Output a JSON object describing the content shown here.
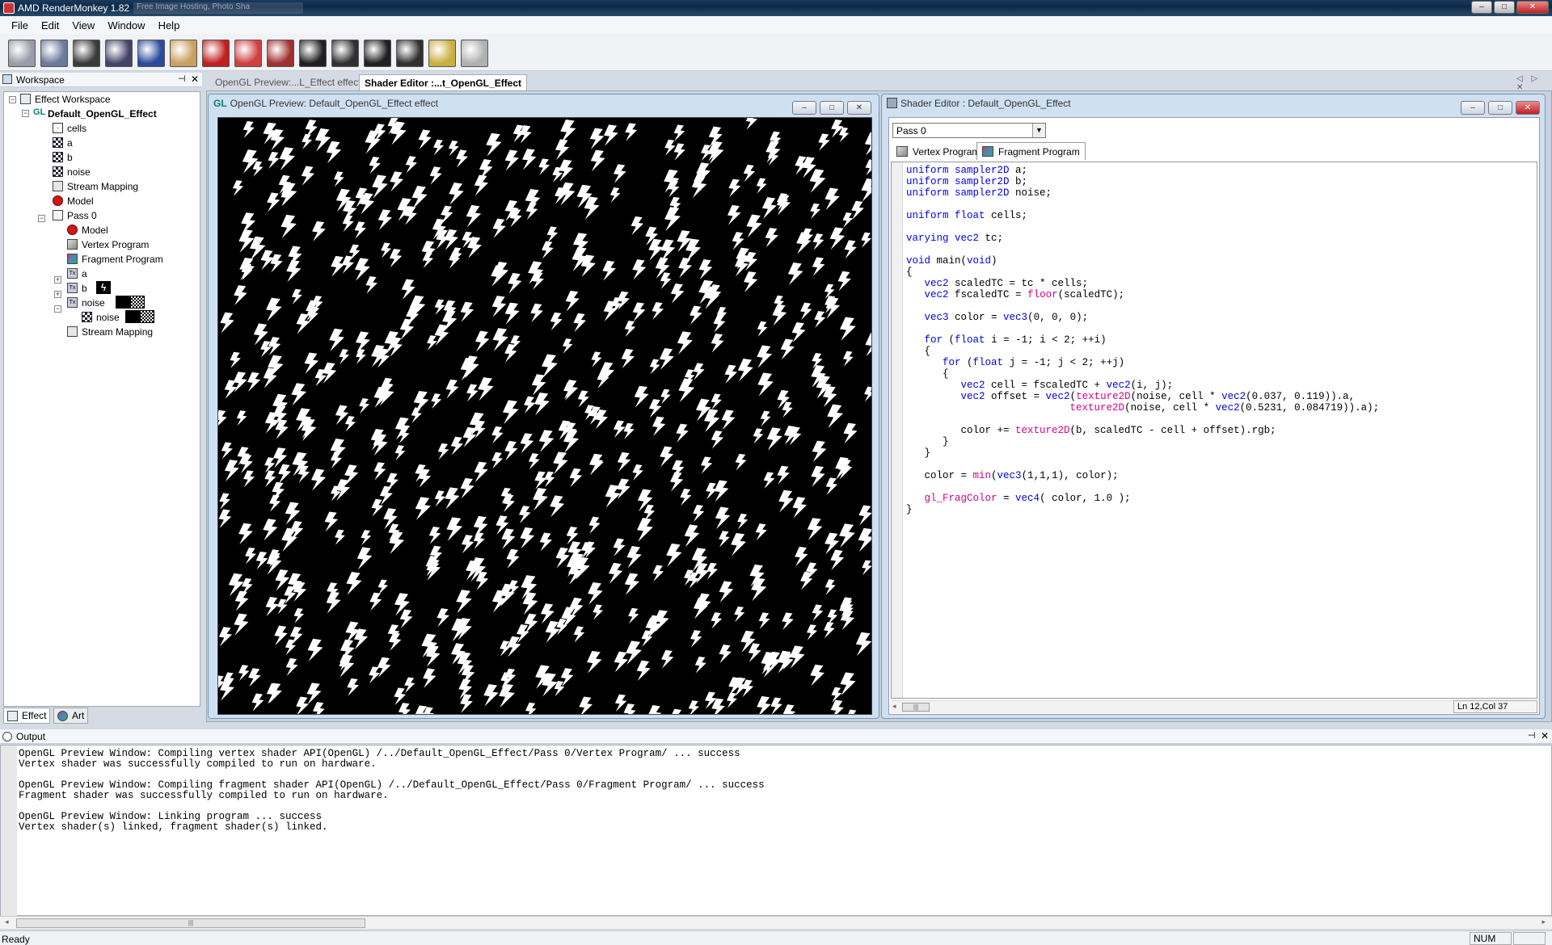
{
  "app": {
    "title": "AMD RenderMonkey 1.82",
    "ghost_tab": "Free Image Hosting, Photo Sha",
    "window_buttons": {
      "minimize": "–",
      "maximize": "□",
      "close": "✕"
    }
  },
  "menu": {
    "items": [
      "File",
      "Edit",
      "View",
      "Window",
      "Help"
    ]
  },
  "toolbar": {
    "buttons": [
      {
        "name": "new-effect-button",
        "icon": "new-effect-icon",
        "color": "#9a9aa8"
      },
      {
        "name": "open-effect-button",
        "icon": "sphere-icon",
        "color": "#6a7a9a"
      },
      {
        "name": "save-effect-button",
        "icon": "save-icon",
        "color": "#3a3a3a"
      },
      {
        "name": "render-button",
        "icon": "render-icon",
        "color": "#444466"
      },
      {
        "name": "preview-button",
        "icon": "orb-icon",
        "color": "#2a4a9a"
      },
      {
        "name": "paint-button",
        "icon": "palette-icon",
        "color": "#c8a060"
      },
      {
        "name": "add-model-button",
        "icon": "model-icon",
        "color": "#c02020"
      },
      {
        "name": "add-variable-button",
        "icon": "variable-icon",
        "color": "#d04040"
      },
      {
        "name": "add-texture-button",
        "icon": "texture-icon",
        "color": "#a03030"
      },
      {
        "name": "camera-button-1",
        "icon": "camera-icon",
        "color": "#202020"
      },
      {
        "name": "camera-button-2",
        "icon": "camera-icon",
        "color": "#303030"
      },
      {
        "name": "camera-button-3",
        "icon": "camera-icon",
        "color": "#202020"
      },
      {
        "name": "camera-button-4",
        "icon": "camera-icon",
        "color": "#303030"
      },
      {
        "name": "camera-button-5",
        "icon": "camera-icon",
        "color": "#c8b040"
      },
      {
        "name": "mouse-button",
        "icon": "mouse-icon",
        "color": "#b0b0b0"
      }
    ]
  },
  "workspace": {
    "title": "Workspace",
    "pin": "⊣",
    "close": "✕",
    "tree": [
      {
        "label": "Effect Workspace",
        "icon": "workspace-icon",
        "bold": false
      },
      {
        "label": "Default_OpenGL_Effect",
        "icon": "gl-icon",
        "icon_text": "GL",
        "bold": true
      },
      {
        "label": "cells",
        "icon": "variable-icon",
        "icon_text": "·",
        "bold": false
      },
      {
        "label": "a",
        "icon": "texture-icon",
        "bold": false
      },
      {
        "label": "b",
        "icon": "texture-icon",
        "bold": false
      },
      {
        "label": "noise",
        "icon": "texture-icon",
        "bold": false
      },
      {
        "label": "Stream Mapping",
        "icon": "stream-mapping-icon",
        "bold": false
      },
      {
        "label": "Model",
        "icon": "model-icon",
        "bold": false
      },
      {
        "label": "Pass 0",
        "icon": "pass-icon",
        "bold": false
      },
      {
        "label": "Model",
        "icon": "model-icon",
        "bold": false
      },
      {
        "label": "Vertex Program",
        "icon": "vertex-program-icon",
        "bold": false
      },
      {
        "label": "Fragment Program",
        "icon": "fragment-program-icon",
        "bold": false
      },
      {
        "label": "a",
        "icon": "texture-object-icon",
        "icon_text": "Tx",
        "bold": false
      },
      {
        "label": "b",
        "icon": "texture-object-icon",
        "icon_text": "Tx",
        "bold": false
      },
      {
        "label": "noise",
        "icon": "texture-object-icon",
        "icon_text": "Tx",
        "bold": false
      },
      {
        "label": "noise",
        "icon": "texture-icon",
        "bold": false
      },
      {
        "label": "Stream Mapping",
        "icon": "stream-mapping-icon",
        "bold": false
      }
    ],
    "tabs": [
      {
        "label": "Effect",
        "icon": "effect-icon"
      },
      {
        "label": "Art",
        "icon": "art-icon"
      }
    ]
  },
  "doc_tabs": [
    {
      "label": "OpenGL Preview:...L_Effect effect",
      "active": false
    },
    {
      "label": "Shader Editor :...t_OpenGL_Effect",
      "active": true
    }
  ],
  "doc_nav": "◁ ▷ ✕",
  "preview": {
    "gl_badge": "GL",
    "title": "OpenGL Preview: Default_OpenGL_Effect effect",
    "background": "#000000",
    "pattern": "white lightning bolts"
  },
  "shader_editor": {
    "title": "Shader Editor : Default_OpenGL_Effect",
    "pass_value": "Pass 0",
    "pass_arrow": "▼",
    "tabs": [
      {
        "label": "Vertex Program",
        "active": false
      },
      {
        "label": "Fragment Program",
        "active": true
      }
    ],
    "code_lines": [
      [
        [
          "kw",
          "uniform sampler2D"
        ],
        [
          "t",
          " a;"
        ]
      ],
      [
        [
          "kw",
          "uniform sampler2D"
        ],
        [
          "t",
          " b;"
        ]
      ],
      [
        [
          "kw",
          "uniform sampler2D"
        ],
        [
          "t",
          " noise;"
        ]
      ],
      [],
      [
        [
          "kw",
          "uniform float"
        ],
        [
          "t",
          " cells;"
        ]
      ],
      [],
      [
        [
          "kw",
          "varying vec2"
        ],
        [
          "t",
          " tc;"
        ]
      ],
      [],
      [
        [
          "kw",
          "void"
        ],
        [
          "t",
          " main("
        ],
        [
          "kw",
          "void"
        ],
        [
          "t",
          ")"
        ]
      ],
      [
        [
          "t",
          "{"
        ]
      ],
      [
        [
          "t",
          "   "
        ],
        [
          "kw",
          "vec2"
        ],
        [
          "t",
          " scaledTC = tc * cells;"
        ]
      ],
      [
        [
          "t",
          "   "
        ],
        [
          "kw",
          "vec2"
        ],
        [
          "t",
          " fscaledTC = "
        ],
        [
          "fn",
          "floor"
        ],
        [
          "t",
          "(scaledTC);"
        ]
      ],
      [],
      [
        [
          "t",
          "   "
        ],
        [
          "kw",
          "vec3"
        ],
        [
          "t",
          " color = "
        ],
        [
          "kw",
          "vec3"
        ],
        [
          "t",
          "(0, 0, 0);"
        ]
      ],
      [],
      [
        [
          "t",
          "   "
        ],
        [
          "kw",
          "for"
        ],
        [
          "t",
          " ("
        ],
        [
          "kw",
          "float"
        ],
        [
          "t",
          " i = -1; i < 2; ++i)"
        ]
      ],
      [
        [
          "t",
          "   {"
        ]
      ],
      [
        [
          "t",
          "      "
        ],
        [
          "kw",
          "for"
        ],
        [
          "t",
          " ("
        ],
        [
          "kw",
          "float"
        ],
        [
          "t",
          " j = -1; j < 2; ++j)"
        ]
      ],
      [
        [
          "t",
          "      {"
        ]
      ],
      [
        [
          "t",
          "         "
        ],
        [
          "kw",
          "vec2"
        ],
        [
          "t",
          " cell = fscaledTC + "
        ],
        [
          "kw",
          "vec2"
        ],
        [
          "t",
          "(i, j);"
        ]
      ],
      [
        [
          "t",
          "         "
        ],
        [
          "kw",
          "vec2"
        ],
        [
          "t",
          " offset = "
        ],
        [
          "kw",
          "vec2"
        ],
        [
          "t",
          "("
        ],
        [
          "fn",
          "texture2D"
        ],
        [
          "t",
          "(noise, cell * "
        ],
        [
          "kw",
          "vec2"
        ],
        [
          "t",
          "(0.037, 0.119)).a,"
        ]
      ],
      [
        [
          "t",
          "                           "
        ],
        [
          "fn",
          "texture2D"
        ],
        [
          "t",
          "(noise, cell * "
        ],
        [
          "kw",
          "vec2"
        ],
        [
          "t",
          "(0.5231, 0.084719)).a);"
        ]
      ],
      [],
      [
        [
          "t",
          "         color += "
        ],
        [
          "fn",
          "texture2D"
        ],
        [
          "t",
          "(b, scaledTC - cell + offset).rgb;"
        ]
      ],
      [
        [
          "t",
          "      }"
        ]
      ],
      [
        [
          "t",
          "   }"
        ]
      ],
      [],
      [
        [
          "t",
          "   color = "
        ],
        [
          "fn",
          "min"
        ],
        [
          "t",
          "("
        ],
        [
          "kw",
          "vec3"
        ],
        [
          "t",
          "(1,1,1), color);"
        ]
      ],
      [],
      [
        [
          "t",
          "   "
        ],
        [
          "fn",
          "gl_FragColor"
        ],
        [
          "t",
          " = "
        ],
        [
          "kw",
          "vec4"
        ],
        [
          "t",
          "( color, 1.0 );"
        ]
      ],
      [
        [
          "t",
          "}"
        ]
      ]
    ],
    "cursor_pos": "Ln 12,Col 37",
    "scroll_left": "◂",
    "scroll_right": "▸",
    "scroll_grip": "|||"
  },
  "output": {
    "title": "Output",
    "pin": "⊣",
    "close": "✕",
    "text": "OpenGL Preview Window: Compiling vertex shader API(OpenGL) /../Default_OpenGL_Effect/Pass 0/Vertex Program/ ... success\nVertex shader was successfully compiled to run on hardware.\n\nOpenGL Preview Window: Compiling fragment shader API(OpenGL) /../Default_OpenGL_Effect/Pass 0/Fragment Program/ ... success\nFragment shader was successfully compiled to run on hardware.\n\nOpenGL Preview Window: Linking program ... success\nVertex shader(s) linked, fragment shader(s) linked.",
    "scroll_left": "◂",
    "scroll_right": "▸",
    "scroll_grip": "|||"
  },
  "status": {
    "ready": "Ready",
    "num": "NUM"
  },
  "colors": {
    "keyword": "#0000e6",
    "builtin": "#d4008a",
    "titlebar": "#0e2a48",
    "mdi_background": "#c7d3e0"
  }
}
